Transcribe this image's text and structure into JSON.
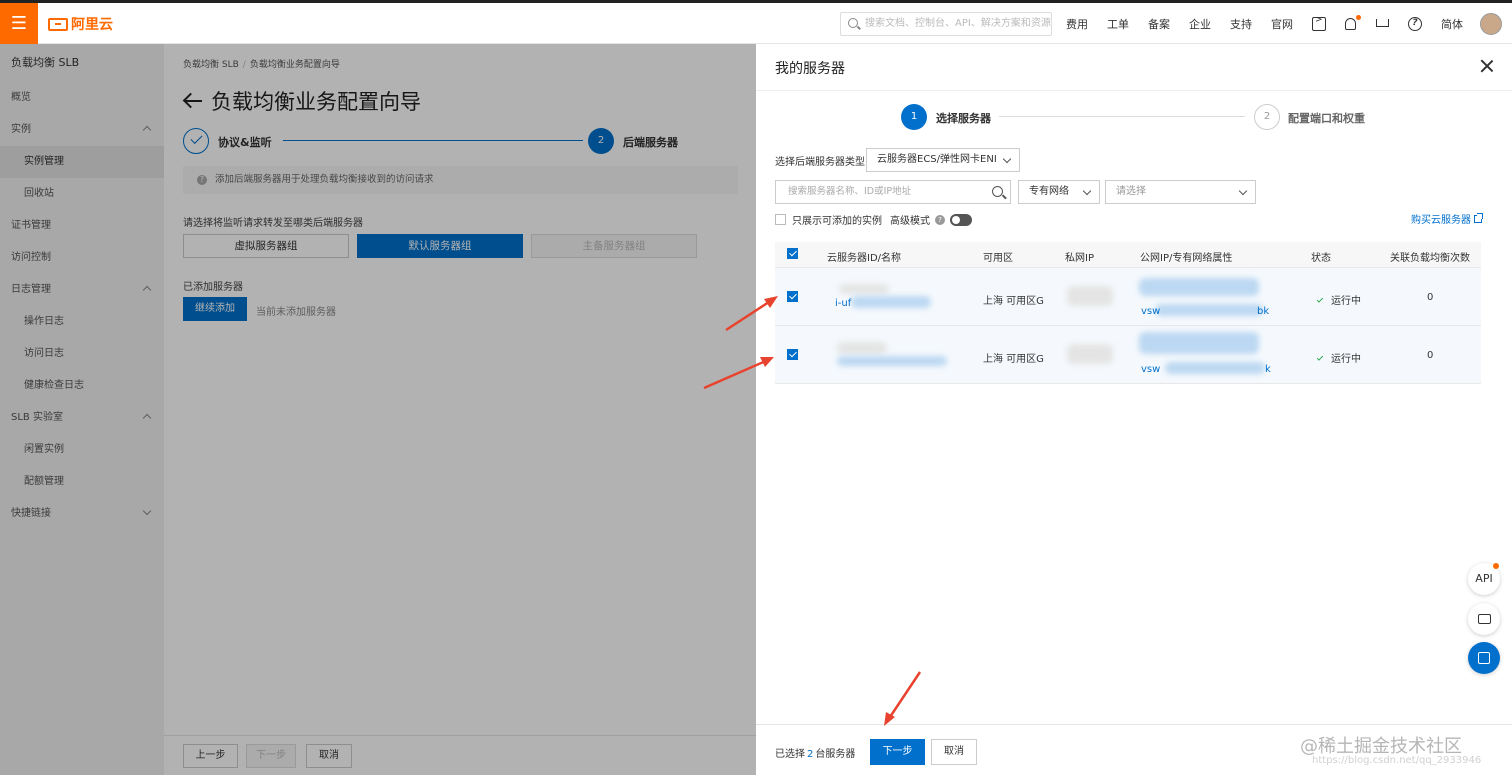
{
  "topbar": {
    "logo": "阿里云",
    "search_placeholder": "搜索文档、控制台、API、解决方案和资源",
    "nav": [
      "费用",
      "工单",
      "备案",
      "企业",
      "支持",
      "官网"
    ],
    "lang": "简体",
    "accent_color": "#ff6a00"
  },
  "sidebar": {
    "title": "负载均衡 SLB",
    "items": [
      {
        "label": "概览",
        "level": 0
      },
      {
        "label": "实例",
        "level": 0,
        "expanded": true
      },
      {
        "label": "实例管理",
        "level": 1,
        "active": true
      },
      {
        "label": "回收站",
        "level": 1
      },
      {
        "label": "证书管理",
        "level": 0
      },
      {
        "label": "访问控制",
        "level": 0
      },
      {
        "label": "日志管理",
        "level": 0,
        "expanded": true
      },
      {
        "label": "操作日志",
        "level": 1
      },
      {
        "label": "访问日志",
        "level": 1
      },
      {
        "label": "健康检查日志",
        "level": 1
      },
      {
        "label": "SLB 实验室",
        "level": 0,
        "expanded": true
      },
      {
        "label": "闲置实例",
        "level": 1
      },
      {
        "label": "配额管理",
        "level": 1
      },
      {
        "label": "快捷链接",
        "level": 0,
        "expanded": false
      }
    ]
  },
  "main": {
    "breadcrumb": [
      "负载均衡 SLB",
      "负载均衡业务配置向导"
    ],
    "title": "负载均衡业务配置向导",
    "steps": [
      {
        "num": "",
        "label": "协议&监听",
        "state": "done"
      },
      {
        "num": "2",
        "label": "后端服务器",
        "state": "active"
      }
    ],
    "tip": "添加后端服务器用于处理负载均衡接收到的访问请求",
    "select_label": "请选择将监听请求转发至哪类后端服务器",
    "groups": [
      "虚拟服务器组",
      "默认服务器组",
      "主备服务器组"
    ],
    "added_label": "已添加服务器",
    "continue_add": "继续添加",
    "none_added": "当前未添加服务器",
    "footer": {
      "prev": "上一步",
      "next": "下一步",
      "cancel": "取消"
    }
  },
  "drawer": {
    "title": "我的服务器",
    "steps": [
      {
        "num": "1",
        "label": "选择服务器",
        "state": "active"
      },
      {
        "num": "2",
        "label": "配置端口和权重",
        "state": "pending"
      }
    ],
    "type_label": "选择后端服务器类型",
    "type_value": "云服务器ECS/弹性网卡ENI",
    "search_placeholder": "搜索服务器名称、ID或IP地址",
    "network_select": "专有网络",
    "vpc_placeholder": "请选择",
    "only_show_label": "只展示可添加的实例",
    "advanced_label": "高级模式",
    "buy_link": "购买云服务器",
    "table": {
      "headers": [
        "云服务器ID/名称",
        "可用区",
        "私网IP",
        "公网IP/专有网络属性",
        "状态",
        "关联负载均衡次数"
      ],
      "rows": [
        {
          "id_prefix": "i-uf",
          "zone": "上海 可用区G",
          "vsw_prefix": "vsw",
          "vsw_suffix": "bk",
          "status": "运行中",
          "count": "0",
          "checked": true
        },
        {
          "id_prefix": "",
          "zone": "上海 可用区G",
          "vsw_prefix": "vsw",
          "vsw_suffix": "k",
          "status": "运行中",
          "count": "0",
          "checked": true
        }
      ]
    },
    "footer": {
      "selected_prefix": "已选择",
      "selected_count": "2",
      "selected_suffix": "台服务器",
      "next": "下一步",
      "cancel": "取消"
    }
  },
  "float": {
    "api": "API"
  },
  "watermark": {
    "line1": "@稀土掘金技术社区",
    "line2": "https://blog.csdn.net/qq_2933946"
  },
  "annotation_color": "#e8432e"
}
